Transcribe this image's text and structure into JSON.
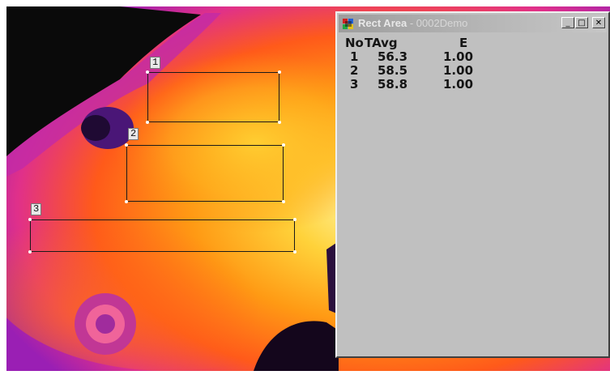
{
  "window": {
    "title": "Rect Area",
    "subtitle": "- 0002Demo",
    "buttons": {
      "minimize": "_",
      "maximize": "□",
      "close": "✕"
    }
  },
  "table": {
    "columns": [
      "No",
      "TAvg",
      "E"
    ],
    "rows": [
      [
        "1",
        "56.3",
        "1.00"
      ],
      [
        "2",
        "58.5",
        "1.00"
      ],
      [
        "3",
        "58.8",
        "1.00"
      ]
    ]
  },
  "regions": [
    {
      "label": "1"
    },
    {
      "label": "2"
    },
    {
      "label": "3"
    }
  ],
  "icons": [
    "app-icon",
    "minimize-icon",
    "maximize-icon",
    "close-icon"
  ],
  "colors": {
    "window_face": "#c0c0c0",
    "title_inactive": "#a0a0a0"
  }
}
